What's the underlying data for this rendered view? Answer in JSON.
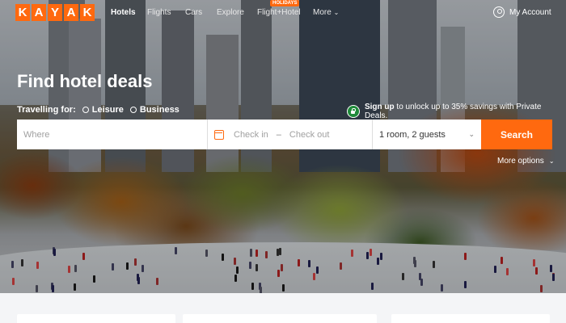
{
  "brand": {
    "letters": [
      "K",
      "A",
      "Y",
      "A",
      "K"
    ],
    "accent_color": "#ff690f"
  },
  "nav": {
    "items": [
      {
        "label": "Hotels",
        "active": true
      },
      {
        "label": "Flights"
      },
      {
        "label": "Cars"
      },
      {
        "label": "Explore"
      },
      {
        "label": "Flight+Hotel",
        "badge": "HOLIDAYS"
      },
      {
        "label": "More"
      }
    ],
    "account_label": "My Account"
  },
  "hero": {
    "title": "Find hotel deals",
    "travelling_for_label": "Travelling for:",
    "options": [
      "Leisure",
      "Business"
    ]
  },
  "signup": {
    "link": "Sign up",
    "text": "to unlock up to 35% savings with Private Deals."
  },
  "search": {
    "where_placeholder": "Where",
    "checkin_placeholder": "Check in",
    "separator": "–",
    "checkout_placeholder": "Check out",
    "guests_value": "1 room, 2 guests",
    "button_label": "Search"
  },
  "more_options_label": "More options"
}
